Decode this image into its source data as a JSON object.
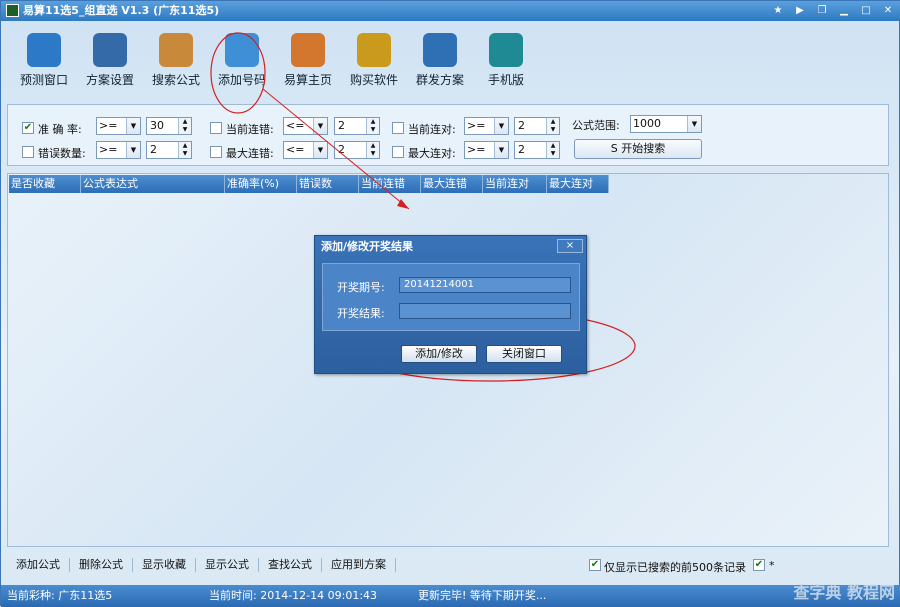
{
  "window": {
    "title": "易算11选5_组直选 V1.3 (广东11选5)"
  },
  "toolbar": [
    {
      "label": "预测窗口",
      "icon": "cloud-icon",
      "color": "#2c79c8"
    },
    {
      "label": "方案设置",
      "icon": "monitor-icon",
      "color": "#356aa8"
    },
    {
      "label": "搜索公式",
      "icon": "calculator-icon",
      "color": "#c88a3a"
    },
    {
      "label": "添加号码",
      "icon": "folder-plus-icon",
      "color": "#3f8fd6"
    },
    {
      "label": "易算主页",
      "icon": "home-icon",
      "color": "#d4772e"
    },
    {
      "label": "购买软件",
      "icon": "key-icon",
      "color": "#c99a1c"
    },
    {
      "label": "群发方案",
      "icon": "users-icon",
      "color": "#2f6fb4"
    },
    {
      "label": "手机版",
      "icon": "phone-icon",
      "color": "#1f8a94"
    }
  ],
  "filters": {
    "accuracy": {
      "label": "准 确 率:",
      "checked": true,
      "op": ">=",
      "value": "30"
    },
    "errors": {
      "label": "错误数量:",
      "checked": false,
      "op": ">=",
      "value": "2"
    },
    "cur_err": {
      "label": "当前连错:",
      "checked": false,
      "op": "<=",
      "value": "2"
    },
    "max_err": {
      "label": "最大连错:",
      "checked": false,
      "op": "<=",
      "value": "2"
    },
    "cur_ok": {
      "label": "当前连对:",
      "checked": false,
      "op": ">=",
      "value": "2"
    },
    "max_ok": {
      "label": "最大连对:",
      "checked": false,
      "op": ">=",
      "value": "2"
    },
    "range": {
      "label": "公式范围:",
      "value": "1000"
    },
    "search_btn": "S 开始搜索"
  },
  "grid": {
    "columns": [
      "是否收藏",
      "公式表达式",
      "准确率(%)",
      "错误数",
      "当前连错",
      "最大连错",
      "当前连对",
      "最大连对"
    ]
  },
  "dialog": {
    "title": "添加/修改开奖结果",
    "close": "×",
    "period_label": "开奖期号:",
    "period_value": "20141214001",
    "result_label": "开奖结果:",
    "result_value": "",
    "add_btn": "添加/修改",
    "close_btn": "关闭窗口"
  },
  "bottom": {
    "buttons": [
      "添加公式",
      "删除公式",
      "显示收藏",
      "显示公式",
      "查找公式",
      "应用到方案"
    ],
    "show_top500": "仅显示已搜索的前500条记录",
    "second_check": "*"
  },
  "status": {
    "lottery": "当前彩种: 广东11选5",
    "time": "当前时间: 2014-12-14 09:01:43",
    "update": "更新完毕! 等待下期开奖..."
  },
  "watermark": "查字典 教程网"
}
